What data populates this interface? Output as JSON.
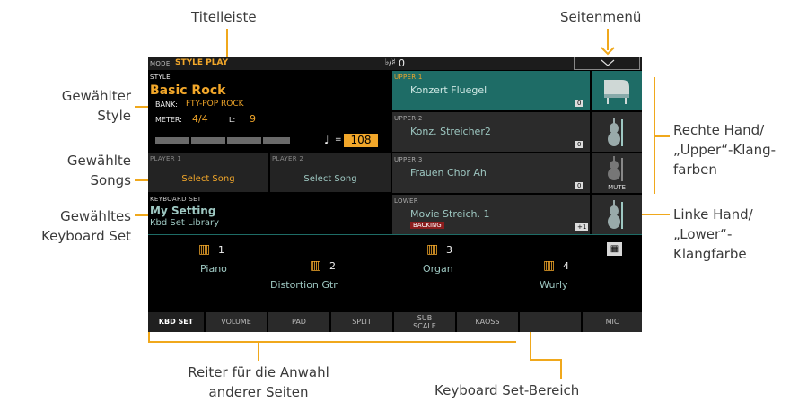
{
  "callouts": {
    "titelleiste": "Titelleiste",
    "seitenmenue": "Seitenmenü",
    "style_line1": "Gewählter",
    "style_line2": "Style",
    "songs_line1": "Gewählte",
    "songs_line2": "Songs",
    "kbdset_line1": "Gewähltes",
    "kbdset_line2": "Keyboard Set",
    "upper_line1": "Rechte Hand/",
    "upper_line2": "„Upper“-Klang-",
    "upper_line3": "farben",
    "lower_line1": "Linke Hand/",
    "lower_line2": "„Lower“-",
    "lower_line3": "Klangfarbe",
    "tabs_line1": "Reiter für die Anwahl",
    "tabs_line2": "anderer Seiten",
    "kbd_area": "Keyboard Set-Bereich"
  },
  "header": {
    "mode_label": "MODE",
    "mode_value": "STYLE PLAY",
    "transpose_label": "♭/♯",
    "transpose_value": "0"
  },
  "style": {
    "section_label": "STYLE",
    "name": "Basic Rock",
    "bank_label": "BANK:",
    "bank_value": "FTY-POP ROCK",
    "meter_label": "METER:",
    "meter_value": "4/4",
    "length_label": "L:",
    "length_value": "9",
    "tempo_value": "108"
  },
  "players": [
    {
      "label": "PLAYER 1",
      "song": "Select Song"
    },
    {
      "label": "PLAYER 2",
      "song": "Select Song"
    }
  ],
  "keyboard_set": {
    "section_label": "KEYBOARD SET",
    "name": "My Setting",
    "library": "Kbd Set Library"
  },
  "tracks": [
    {
      "label": "UPPER 1",
      "sound": "Konzert Fluegel",
      "octave": "0",
      "icon": "grand-piano-icon",
      "muted": false
    },
    {
      "label": "UPPER 2",
      "sound": "Konz. Streicher2",
      "octave": "0",
      "icon": "violin-icon",
      "muted": false
    },
    {
      "label": "UPPER 3",
      "sound": "Frauen Chor Ah",
      "octave": "0",
      "icon": "violin-icon",
      "muted": true,
      "mute_label": "MUTE"
    },
    {
      "label": "LOWER",
      "sound": "Movie Streich. 1",
      "octave": "+1",
      "icon": "violin-icon",
      "muted": false,
      "badge": "BACKING"
    }
  ],
  "kbd_slots": [
    {
      "number": "1",
      "name": "Piano"
    },
    {
      "number": "2",
      "name": "Distortion Gtr"
    },
    {
      "number": "3",
      "name": "Organ"
    },
    {
      "number": "4",
      "name": "Wurly"
    }
  ],
  "tabs": [
    {
      "label": "KBD SET",
      "active": true
    },
    {
      "label": "VOLUME"
    },
    {
      "label": "PAD"
    },
    {
      "label": "SPLIT"
    },
    {
      "label1": "SUB",
      "label2": "SCALE"
    },
    {
      "label": "KAOSS"
    },
    {
      "label": ""
    },
    {
      "label": "MIC"
    }
  ],
  "colors": {
    "accent_orange": "#f2a72a",
    "teal_selected": "#1e6c66",
    "teal_text": "#9ec8c2",
    "callout_line": "#f0a81c"
  }
}
